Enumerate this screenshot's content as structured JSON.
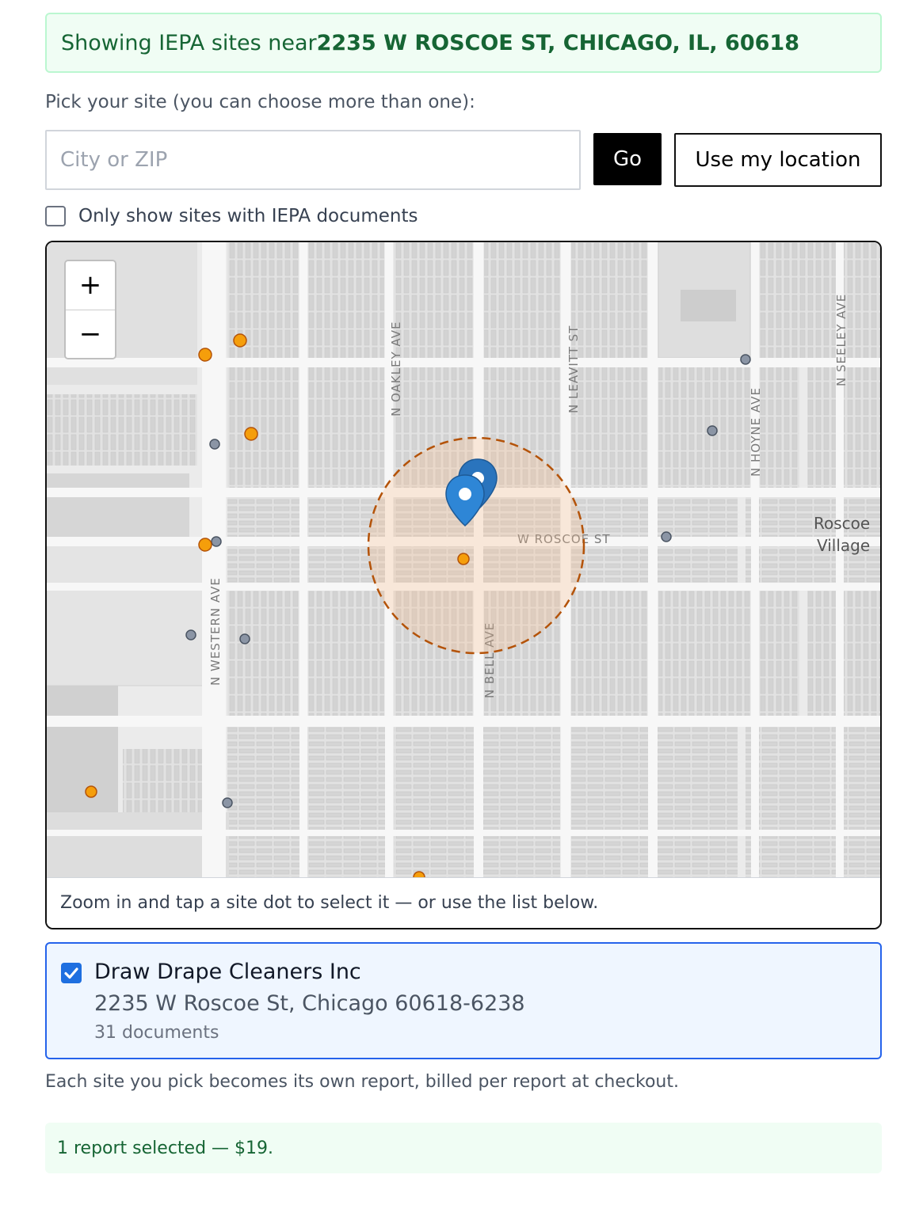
{
  "banner": {
    "prefix": "Showing IEPA sites near ",
    "address": "2235 W ROSCOE ST, CHICAGO, IL, 60618"
  },
  "picker": {
    "label": "Pick your site (you can choose more than one):",
    "placeholder": "City or ZIP",
    "go_label": "Go",
    "location_label": "Use my location",
    "filter_label": "Only show sites with IEPA documents",
    "filter_checked": false
  },
  "map": {
    "zoom_in": "+",
    "zoom_out": "−",
    "street_labels": {
      "oakley": "N OAKLEY AVE",
      "leavitt": "N LEAVITT ST",
      "hoyne": "N HOYNE AVE",
      "seeley": "N SEELEY AVE",
      "western": "N WESTERN AVE",
      "bell": "N BELL AVE",
      "roscoe": "W ROSCOE ST"
    },
    "neighborhood": {
      "line1": "Roscoe",
      "line2": "Village"
    },
    "hint": "Zoom in and tap a site dot to select it — or use the list below.",
    "colors": {
      "with_docs": "#f59e0b",
      "no_docs": "#8b95a5",
      "marker": "#2e86d6",
      "radius": "#b45309"
    }
  },
  "selected_site": {
    "checked": true,
    "name": "Draw Drape Cleaners Inc",
    "address": "2235 W Roscoe St, Chicago 60618-6238",
    "documents": "31 documents"
  },
  "billing_note": "Each site you pick becomes its own report, billed per report at checkout.",
  "summary": "1 report selected — $19."
}
